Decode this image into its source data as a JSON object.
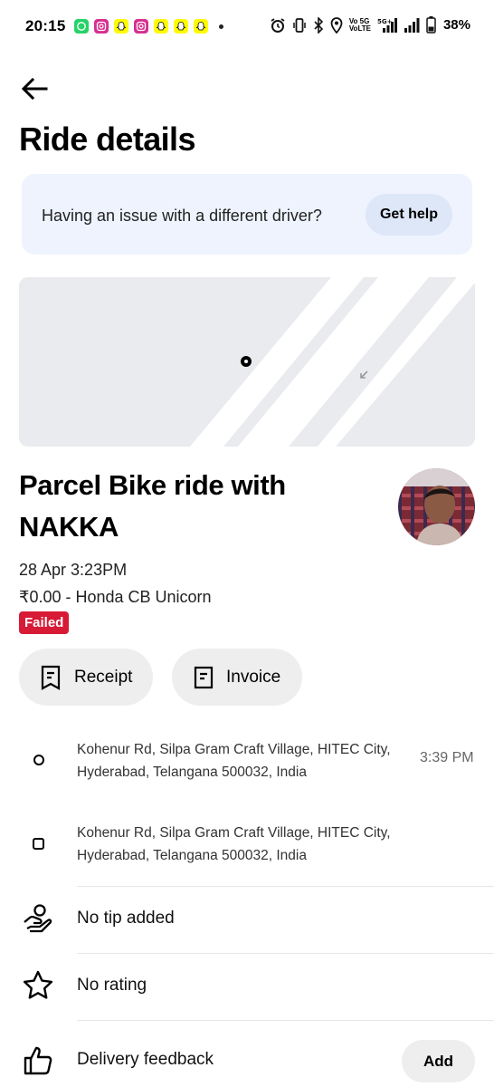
{
  "status_bar": {
    "time": "20:15",
    "network_label_top": "Vo 5G",
    "network_label_bottom": "VoLTE",
    "network_5g": "5G+",
    "battery": "38%"
  },
  "header": {
    "back_icon": "arrow-left-icon",
    "title": "Ride details"
  },
  "banner": {
    "text": "Having an issue with a different driver?",
    "button": "Get help"
  },
  "ride": {
    "title": "Parcel Bike ride with NAKKA",
    "datetime": "28 Apr 3:23PM",
    "price_vehicle": "₹0.00 - Honda CB Unicorn",
    "status": "Failed"
  },
  "actions": {
    "receipt": "Receipt",
    "invoice": "Invoice"
  },
  "trip": {
    "pickup_address": "Kohenur Rd, Silpa Gram Craft Village, HITEC City, Hyderabad, Telangana 500032, India",
    "pickup_time": "3:39 PM",
    "dropoff_address": "Kohenur Rd, Silpa Gram Craft Village, HITEC City, Hyderabad, Telangana 500032, India"
  },
  "rows": {
    "tip": "No tip added",
    "rating": "No rating",
    "feedback": "Delivery feedback",
    "feedback_button": "Add"
  },
  "colors": {
    "accent_failed": "#d71a35",
    "banner_bg": "#eef3fd",
    "pill_bg": "#eeeeee"
  }
}
